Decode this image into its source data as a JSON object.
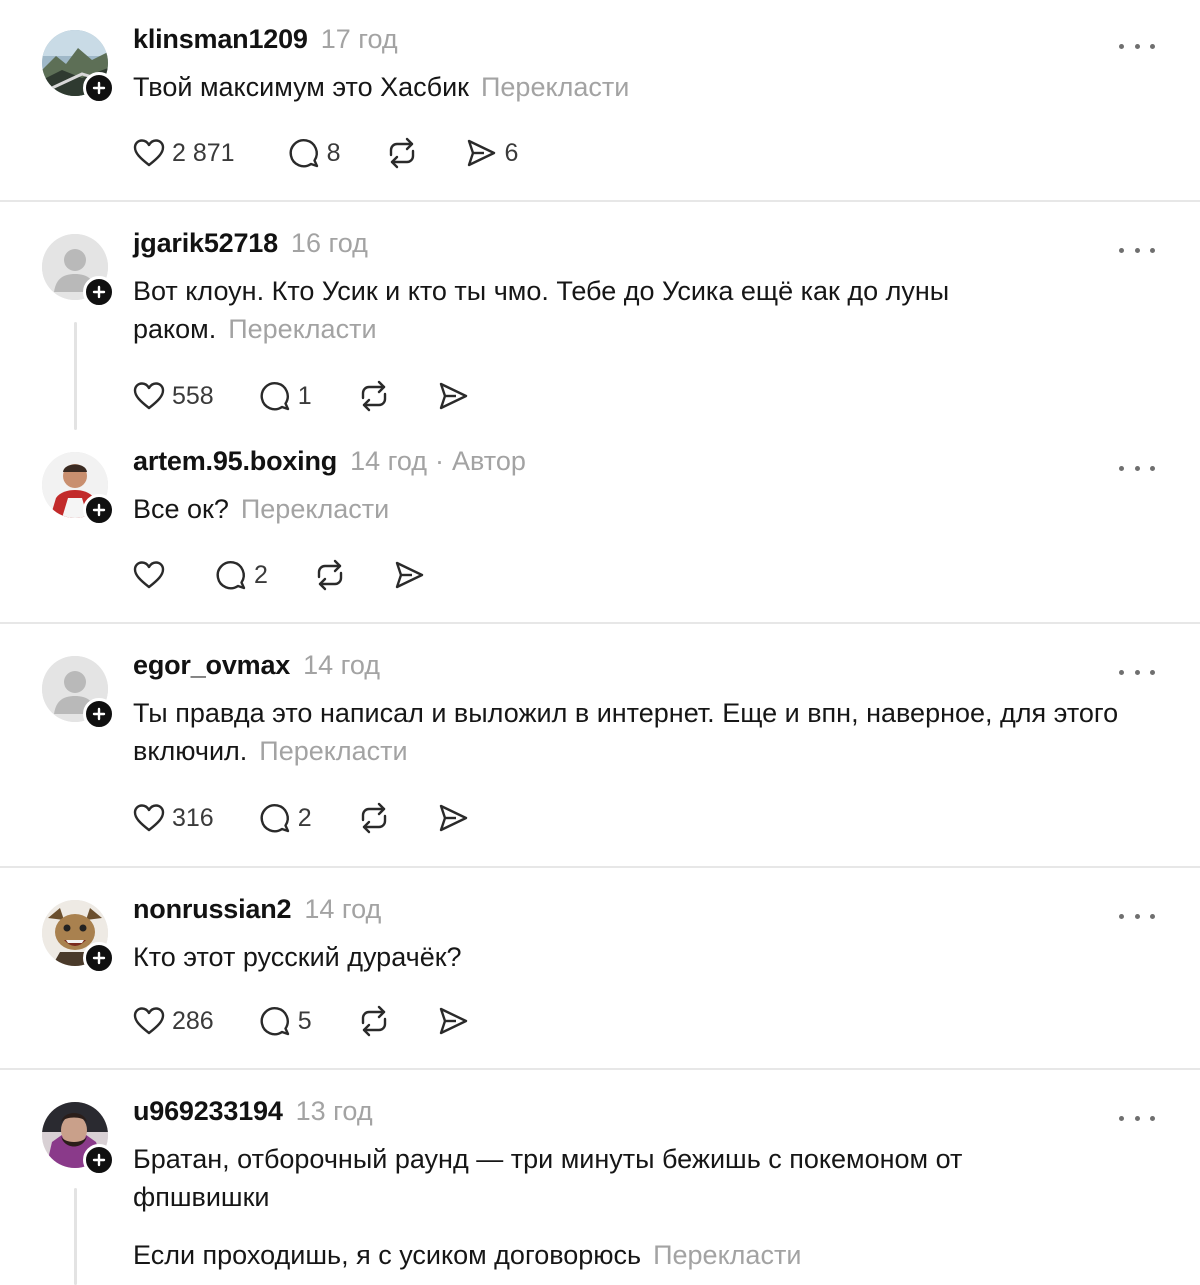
{
  "translate_label": "Перекласти",
  "author_label": "Автор",
  "posts": [
    {
      "username": "klinsman1209",
      "time": "17 год",
      "text": "Твой максимум это Хасбик",
      "likes": "2 871",
      "replies": "8",
      "reposts": "",
      "shares": "6",
      "is_author": false
    },
    {
      "username": "jgarik52718",
      "time": "16 год",
      "text": "Вот клоун. Кто Усик и кто ты чмо. Тебе до Усика ещё как до луны раком.",
      "likes": "558",
      "replies": "1",
      "reposts": "",
      "shares": "",
      "is_author": false
    },
    {
      "username": "artem.95.boxing",
      "time": "14 год",
      "text": "Все ок?",
      "likes": "",
      "replies": "2",
      "reposts": "",
      "shares": "",
      "is_author": true
    },
    {
      "username": "egor_ovmax",
      "time": "14 год",
      "text": "Ты правда это написал и выложил в интернет. Еще и впн, наверное, для этого включил.",
      "likes": "316",
      "replies": "2",
      "reposts": "",
      "shares": "",
      "is_author": false
    },
    {
      "username": "nonrussian2",
      "time": "14 год",
      "text": "Кто этот русский дурачёк?",
      "likes": "286",
      "replies": "5",
      "reposts": "",
      "shares": "",
      "is_author": false
    },
    {
      "username": "u969233194",
      "time": "13 год",
      "text": "Братан, отборочный раунд — три минуты бежишь с покемоном от фпшвишки",
      "text2": "Если проходишь, я с усиком договорюсь",
      "is_author": false
    }
  ]
}
